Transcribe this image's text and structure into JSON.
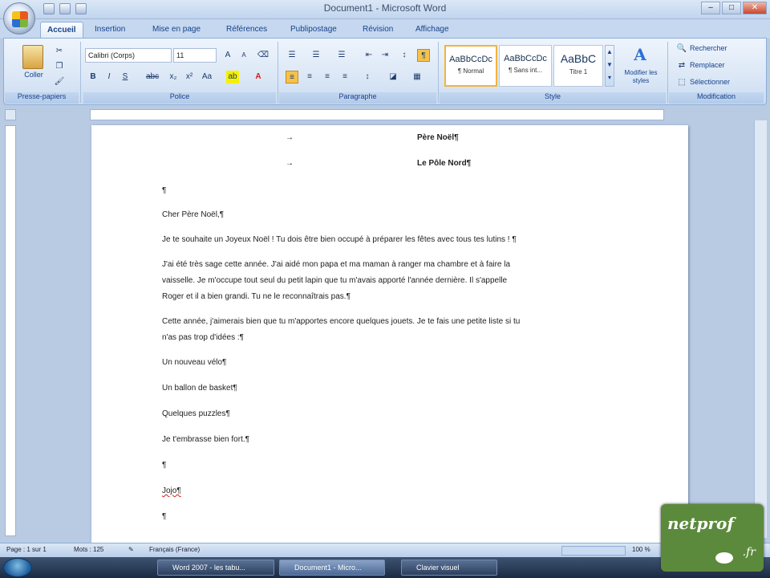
{
  "window": {
    "title": "Document1 - Microsoft Word",
    "buttons": {
      "minimize": "–",
      "maximize": "□",
      "close": "✕"
    }
  },
  "tabs": [
    "Accueil",
    "Insertion",
    "Mise en page",
    "Références",
    "Publipostage",
    "Révision",
    "Affichage"
  ],
  "ribbon": {
    "clipboard": {
      "paste_label": "Coller",
      "group": "Presse-papiers"
    },
    "font": {
      "name": "Calibri (Corps)",
      "size": "11",
      "group": "Police"
    },
    "paragraph": {
      "group": "Paragraphe"
    },
    "styles": {
      "group": "Style",
      "items": [
        {
          "sample": "AaBbCcDc",
          "name": "¶ Normal"
        },
        {
          "sample": "AaBbCcDc",
          "name": "¶ Sans int..."
        },
        {
          "sample": "AaBbC",
          "name": "Titre 1"
        }
      ],
      "change_label": "Modifier les styles"
    },
    "editing": {
      "group": "Modification",
      "find": "Rechercher",
      "replace": "Remplacer",
      "select": "Sélectionner"
    }
  },
  "document": {
    "lines": [
      {
        "text": "Père Noël¶",
        "bold": true
      },
      {
        "text": "Le Pôle Nord¶",
        "bold": true
      },
      {
        "text": "¶"
      },
      {
        "text": "Cher Père Noël,¶"
      },
      {
        "text": "Je te souhaite un Joyeux Noël ! Tu dois être bien occupé à préparer les fêtes avec tous tes lutins ! ¶"
      },
      {
        "text": "J'ai été très sage cette année. J'ai aidé mon papa et ma maman à ranger ma chambre et à faire la"
      },
      {
        "text": "vaisselle. Je m'occupe tout seul du petit lapin que tu m'avais apporté l'année dernière. Il s'appelle"
      },
      {
        "text": "Roger et il a bien grandi. Tu ne le reconnaîtrais pas.¶"
      },
      {
        "text": "Cette année, j'aimerais bien que tu m'apportes encore quelques jouets. Je te fais une petite liste si tu"
      },
      {
        "text": "n'as pas trop d'idées :¶"
      },
      {
        "text": "Un nouveau vélo¶"
      },
      {
        "text": "Un ballon de basket¶"
      },
      {
        "text": "Quelques puzzles¶"
      },
      {
        "text": "Je t'embrasse bien fort.¶"
      },
      {
        "text": "¶"
      },
      {
        "text": "Jojo¶"
      },
      {
        "text": "¶"
      }
    ]
  },
  "status": {
    "page": "Page : 1 sur 1",
    "words": "Mots : 125",
    "language": "Français (France)",
    "zoom": "100 %"
  },
  "taskbar": {
    "items": [
      "Word 2007 - les tabu...",
      "Document1 - Micro...",
      "Clavier visuel"
    ]
  },
  "watermark": {
    "brand": "netprof",
    "tld": ".fr"
  }
}
